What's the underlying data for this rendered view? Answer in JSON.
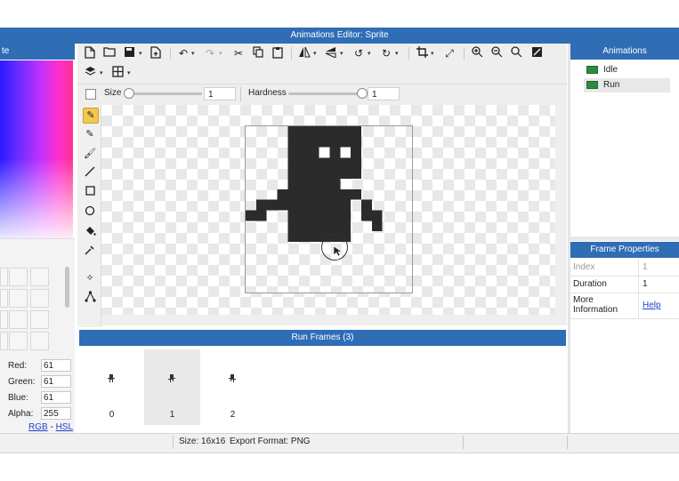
{
  "window": {
    "title": "Animations Editor: Sprite"
  },
  "left_panel": {
    "header": "te",
    "color": {
      "red": "61",
      "green": "61",
      "blue": "61",
      "alpha": "255"
    },
    "labels": {
      "red": "Red:",
      "green": "Green:",
      "blue": "Blue:",
      "alpha": "Alpha:"
    },
    "mode_links": {
      "rgb": "RGB",
      "dash": "-",
      "hsl": "HSL"
    },
    "current_color": "#3d3d3d"
  },
  "brush": {
    "size_label": "Size",
    "size_value": "1",
    "hardness_label": "Hardness",
    "hardness_value": "1"
  },
  "frames_panel": {
    "title": "Run Frames (3)",
    "frames": [
      {
        "index": "0",
        "selected": false
      },
      {
        "index": "1",
        "selected": true
      },
      {
        "index": "2",
        "selected": false
      }
    ]
  },
  "animations_panel": {
    "title": "Animations",
    "items": [
      {
        "label": "Idle",
        "selected": false
      },
      {
        "label": "Run",
        "selected": true
      }
    ]
  },
  "frame_properties": {
    "title": "Frame Properties",
    "rows": [
      {
        "key": "Index",
        "value": "1"
      },
      {
        "key": "Duration",
        "value": "1"
      },
      {
        "key": "More Information",
        "value": "Help"
      }
    ]
  },
  "status_bar": {
    "size": "Size: 16x16",
    "export": "Export Format: PNG"
  },
  "colors": {
    "accent": "#2f6db5",
    "sprite": "#2b2b2b",
    "anim_icon": "#2e8b3d"
  },
  "icons": [
    "new-file-icon",
    "open-folder-icon",
    "save-icon",
    "export-icon",
    "undo-icon",
    "redo-icon",
    "cut-icon",
    "copy-icon",
    "paste-icon",
    "flip-horizontal-icon",
    "flip-vertical-icon",
    "rotate-left-icon",
    "rotate-right-icon",
    "crop-icon",
    "resize-icon",
    "zoom-in-icon",
    "zoom-out-icon",
    "zoom-fit-icon",
    "fill-canvas-icon",
    "layers-icon",
    "grid-icon",
    "eraser-icon",
    "pencil-icon",
    "brush-icon",
    "line-icon",
    "rectangle-icon",
    "ellipse-icon",
    "fill-bucket-icon",
    "eyedropper-icon",
    "move-icon",
    "nodes-icon"
  ]
}
